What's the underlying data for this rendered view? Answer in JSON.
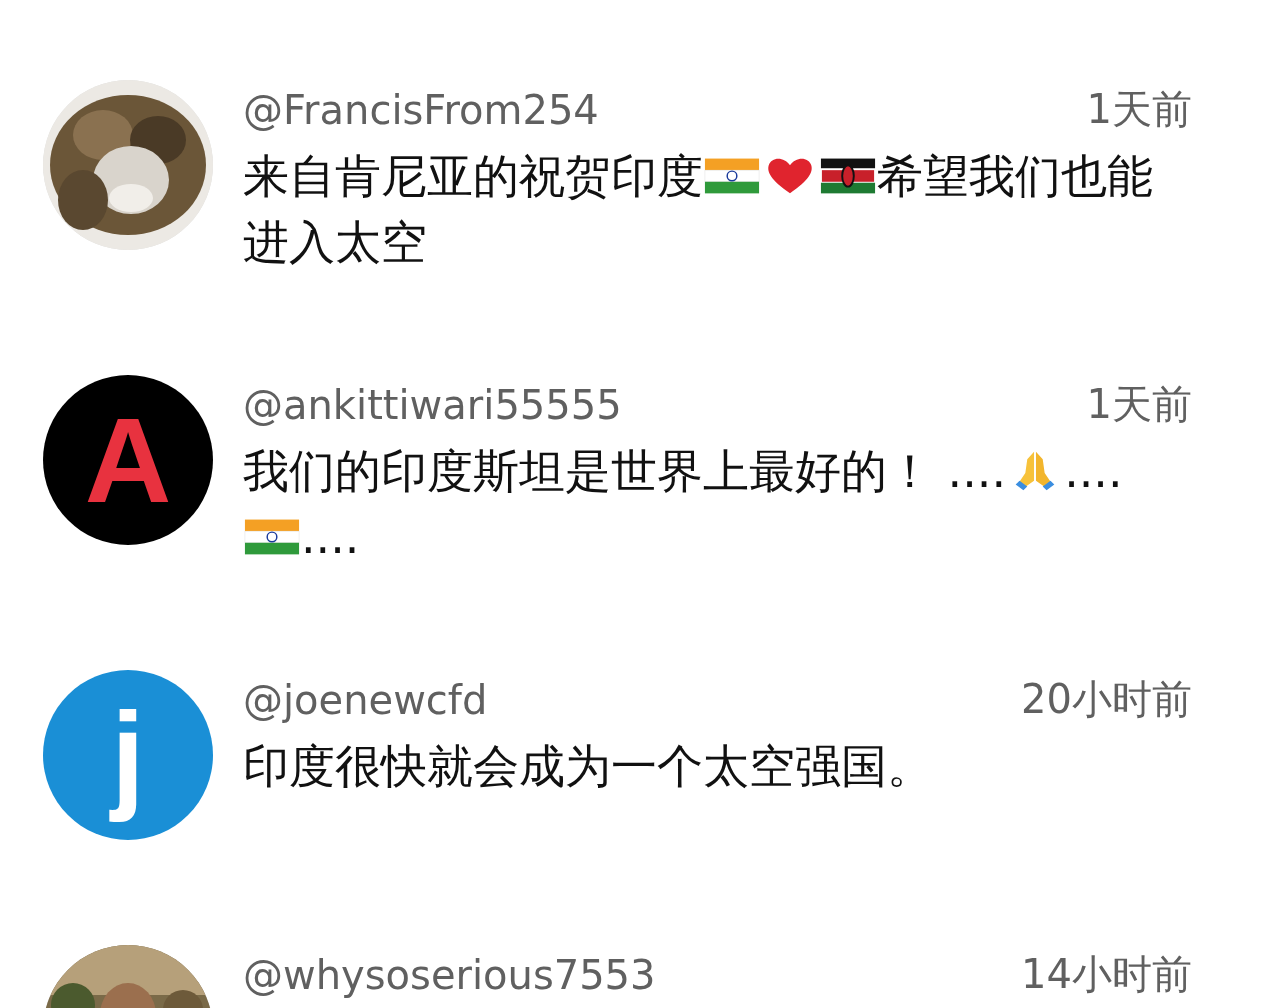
{
  "comments": [
    {
      "username": "@FrancisFrom254",
      "time": "1天前",
      "body": [
        {
          "kind": "text",
          "text": "来自肯尼亚的祝贺印度"
        },
        {
          "kind": "indiaflag"
        },
        {
          "kind": "heart"
        },
        {
          "kind": "kenyaflag"
        },
        {
          "kind": "text",
          "text": "希望我们也能进入太空"
        }
      ]
    },
    {
      "avatar": {
        "kind": "logo",
        "letter": "A"
      },
      "username": "@ankittiwari55555",
      "time": "1天前",
      "body": [
        {
          "kind": "text",
          "text": "我们的印度斯坦是世界上最好的！ ...."
        },
        {
          "kind": "prayinghands"
        },
        {
          "kind": "text",
          "text": "...."
        },
        {
          "kind": "indiaflag"
        },
        {
          "kind": "text",
          "text": "...."
        }
      ]
    },
    {
      "avatar": {
        "kind": "letter",
        "letter": "j",
        "color": "#1a8fd6"
      },
      "username": "@joenewcfd",
      "time": "20小时前",
      "body": [
        {
          "kind": "text",
          "text": "印度很快就会成为一个太空强国。"
        }
      ]
    },
    {
      "username": "@whysoserious7553",
      "time": "14小时前"
    }
  ]
}
